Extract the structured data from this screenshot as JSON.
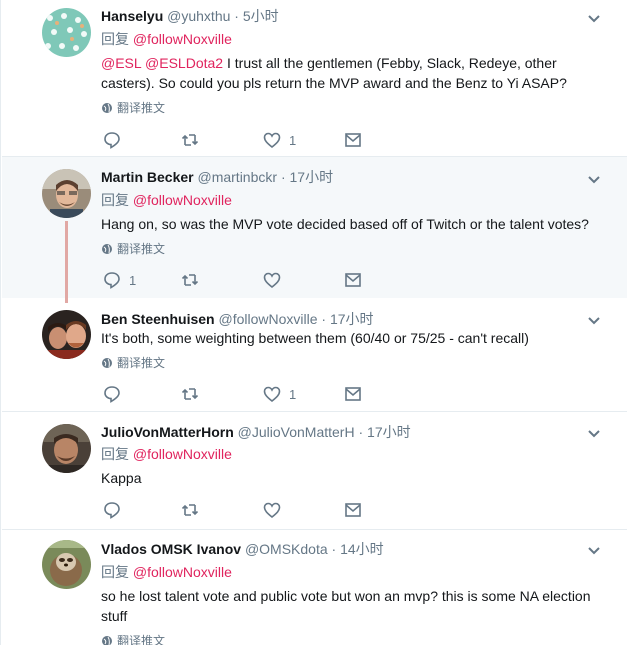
{
  "tweets": [
    {
      "name": "Hanselyu",
      "handle": "@yuhxthu",
      "time": "5小时",
      "reply_prefix": "回复",
      "reply_to": "@followNoxville",
      "mention1": "@ESL",
      "mention2": "@ESLDota2",
      "text": " I trust all the gentlemen (Febby, Slack, Redeye, other casters). So could you pls return the MVP award and the Benz to Yi ASAP?",
      "translate": "翻译推文",
      "reply_count": "",
      "retweet_count": "",
      "like_count": "1"
    },
    {
      "name": "Martin Becker",
      "handle": "@martinbckr",
      "time": "17小时",
      "reply_prefix": "回复",
      "reply_to": "@followNoxville",
      "text": "Hang on, so was the MVP vote decided based off of Twitch or the talent votes?",
      "translate": "翻译推文",
      "reply_count": "1",
      "retweet_count": "",
      "like_count": ""
    },
    {
      "name": "Ben Steenhuisen",
      "handle": "@followNoxville",
      "time": "17小时",
      "text": "It's both, some weighting between them (60/40 or 75/25 - can't recall)",
      "translate": "翻译推文",
      "reply_count": "",
      "retweet_count": "",
      "like_count": "1"
    },
    {
      "name": "JulioVonMatterHorn",
      "handle": "@JulioVonMatterH",
      "time": "17小时",
      "reply_prefix": "回复",
      "reply_to": "@followNoxville",
      "text": "Kappa",
      "reply_count": "",
      "retweet_count": "",
      "like_count": ""
    },
    {
      "name": "Vlados OMSK Ivanov",
      "handle": "@OMSKdota",
      "time": "14小时",
      "reply_prefix": "回复",
      "reply_to": "@followNoxville",
      "text": "so he lost talent vote and public vote but won an mvp? this is some NA election stuff",
      "translate": "翻译推文"
    }
  ],
  "colors": {
    "link": "#e0245e",
    "muted": "#657786",
    "thread": "#e1a8a4",
    "highlight_bg": "#f5f8fa"
  },
  "icons": [
    "reply-icon",
    "retweet-icon",
    "like-icon",
    "dm-icon",
    "globe-icon",
    "caret-down-icon"
  ]
}
